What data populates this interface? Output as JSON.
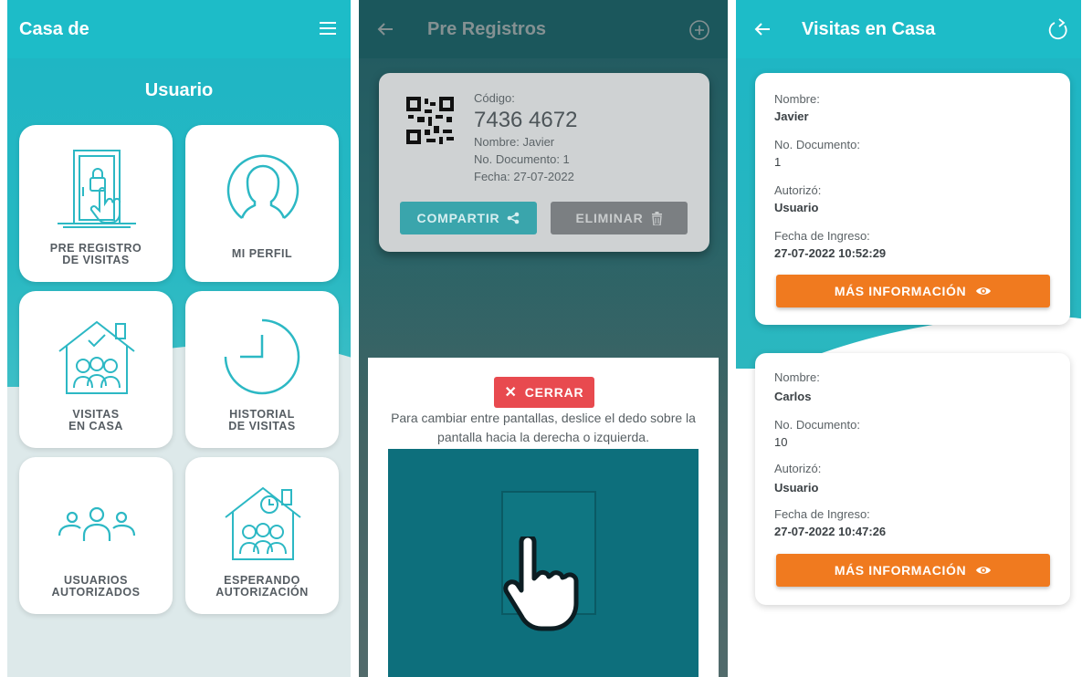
{
  "screen1": {
    "title": "Casa de",
    "section_title": "Usuario",
    "tiles": [
      {
        "line1": "PRE REGISTRO",
        "line2": "DE VISITAS"
      },
      {
        "line1": "MI PERFIL",
        "line2": ""
      },
      {
        "line1": "VISITAS",
        "line2": "EN CASA"
      },
      {
        "line1": "HISTORIAL",
        "line2": "DE VISITAS"
      },
      {
        "line1": "USUARIOS",
        "line2": "AUTORIZADOS"
      },
      {
        "line1": "ESPERANDO",
        "line2": "AUTORIZACIÓN"
      }
    ]
  },
  "screen2": {
    "title": "Pre Registros",
    "card": {
      "code_label": "Código:",
      "code": "7436 4672",
      "name": "Nombre: Javier",
      "document": "No. Documento: 1",
      "date": "Fecha: 27-07-2022",
      "share_label": "COMPARTIR",
      "delete_label": "ELIMINAR"
    },
    "help": {
      "close_label": "CERRAR",
      "line1": "Para cambiar entre pantallas, deslice el dedo sobre la",
      "line2": "pantalla hacia la derecha o izquierda."
    }
  },
  "screen3": {
    "title": "Visitas en Casa",
    "labels": {
      "name": "Nombre:",
      "document": "No. Documento:",
      "authorized": "Autorizó:",
      "date": "Fecha de Ingreso:"
    },
    "visits": [
      {
        "name": "Javier",
        "document": "1",
        "authorized": "Usuario",
        "date": "27-07-2022 10:52:29",
        "button": "MÁS INFORMACIÓN"
      },
      {
        "name": "Carlos",
        "document": "10",
        "authorized": "Usuario",
        "date": "27-07-2022 10:47:26",
        "button": "MÁS INFORMACIÓN"
      }
    ]
  },
  "colors": {
    "teal": "#1dbcc8",
    "orange": "#f07a1f",
    "red": "#e84a4f",
    "icon_teal": "#2cb8c4"
  }
}
